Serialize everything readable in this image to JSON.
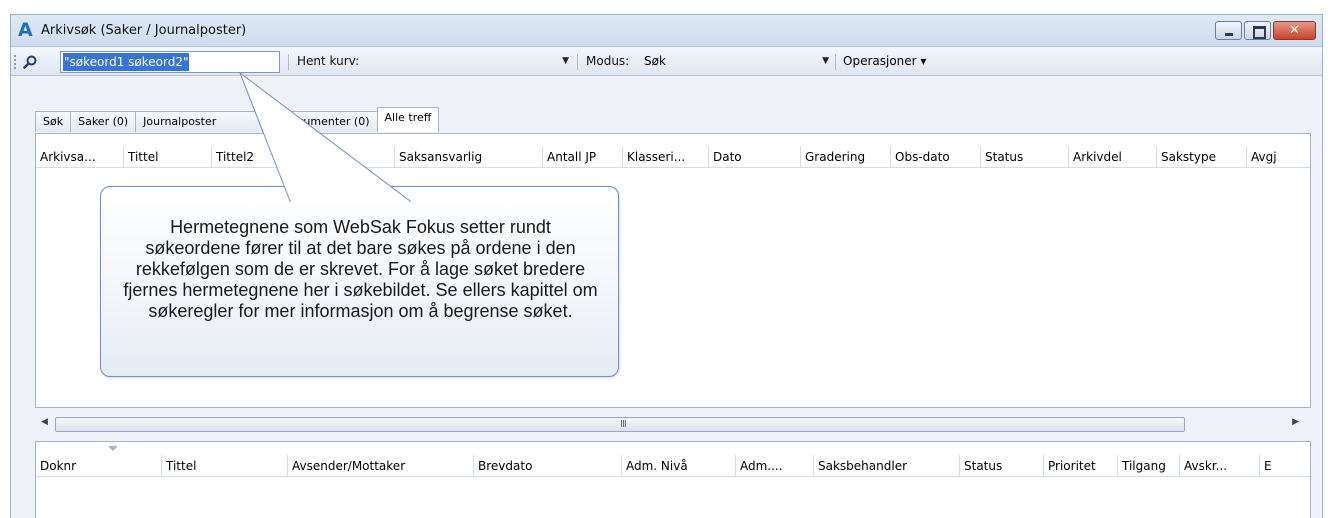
{
  "window": {
    "title": "Arkivsøk (Saker / Journalposter)",
    "app_icon_glyph": "A",
    "controls": {
      "close_glyph": "✕"
    }
  },
  "toolbar": {
    "search_value": "\"søkeord1 søkeord2\"",
    "hent_kurv_label": "Hent kurv:",
    "hent_kurv_value": "",
    "modus_label": "Modus:",
    "modus_value": "Søk",
    "operations_label": "Operasjoner ▾",
    "dropdown_arrow": "▼"
  },
  "tabs": [
    {
      "label": "Søk"
    },
    {
      "label": "Saker (0)"
    },
    {
      "label": "Journalposter"
    },
    {
      "label": "Dokumenter (0)"
    },
    {
      "label": "Alle treff"
    }
  ],
  "top_grid": {
    "columns": [
      "Arkivsa...",
      "Tittel",
      "Tittel2",
      "",
      "Saksansvarlig",
      "Antall JP",
      "Klasseri...",
      "Dato",
      "Gradering",
      "Obs-dato",
      "Status",
      "Arkivdel",
      "Sakstype",
      "Avgj"
    ]
  },
  "scrollbar": {
    "left_arrow": "◀",
    "right_arrow": "▶",
    "grip": "III"
  },
  "bottom_grid": {
    "columns": [
      "Doknr",
      "Tittel",
      "Avsender/Mottaker",
      "Brevdato",
      "Adm. Nivå",
      "Adm....",
      "Saksbehandler",
      "Status",
      "Prioritet",
      "Tilgang",
      "Avskr...",
      "E"
    ]
  },
  "callout": {
    "text": "Hermetegnene som WebSak Fokus setter rundt søkeordene fører til at det bare søkes på ordene i den rekkefølgen som de er skrevet. For å lage søket bredere fjernes hermetegnene her i søkebildet. Se ellers kapittel om søkeregler for mer informasjon om å begrense søket."
  },
  "colors": {
    "accent": "#3874d8",
    "callout_border": "#6f8fc7",
    "close_button": "#c8442a"
  }
}
